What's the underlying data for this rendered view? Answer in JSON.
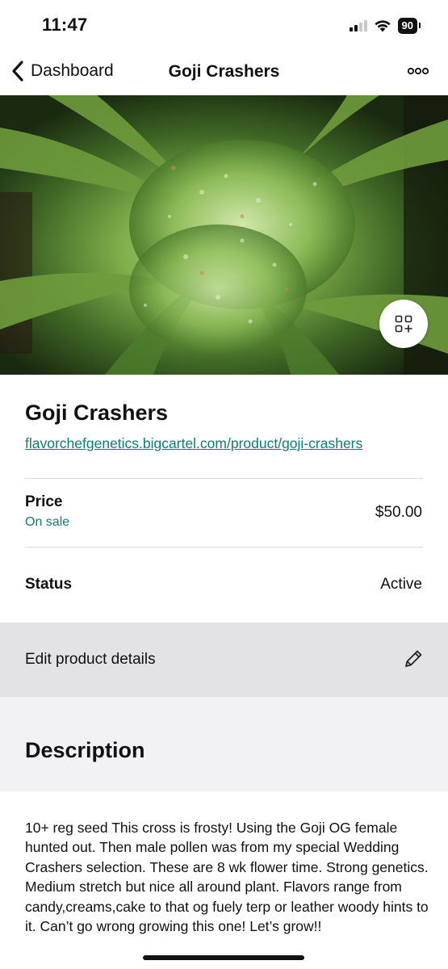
{
  "status_bar": {
    "time": "11:47",
    "battery": "90"
  },
  "nav": {
    "back_label": "Dashboard",
    "title": "Goji Crashers"
  },
  "product": {
    "title": "Goji Crashers",
    "url": "flavorchefgenetics.bigcartel.com/product/goji-crashers",
    "price_label": "Price",
    "price_sub": "On sale",
    "price_value": "$50.00",
    "status_label": "Status",
    "status_value": "Active",
    "edit_label": "Edit product details"
  },
  "description": {
    "heading": "Description",
    "body": "10+ reg seed This cross is frosty! Using the Goji OG female hunted out. Then male pollen was from my special Wedding Crashers selection. These are 8 wk flower time. Strong genetics. Medium stretch but nice all around plant. Flavors range from candy,creams,cake to that og fuely terp or leather woody hints to it. Can’t go wrong growing this one! Let’s grow!!"
  },
  "colors": {
    "link": "#0e7c75",
    "edit_row_bg": "#e3e3e6",
    "section_bg": "#f2f2f4"
  },
  "icons": {
    "back": "chevron-left-icon",
    "more": "more-horizontal-icon",
    "gallery": "gallery-add-icon",
    "edit": "pencil-icon"
  }
}
